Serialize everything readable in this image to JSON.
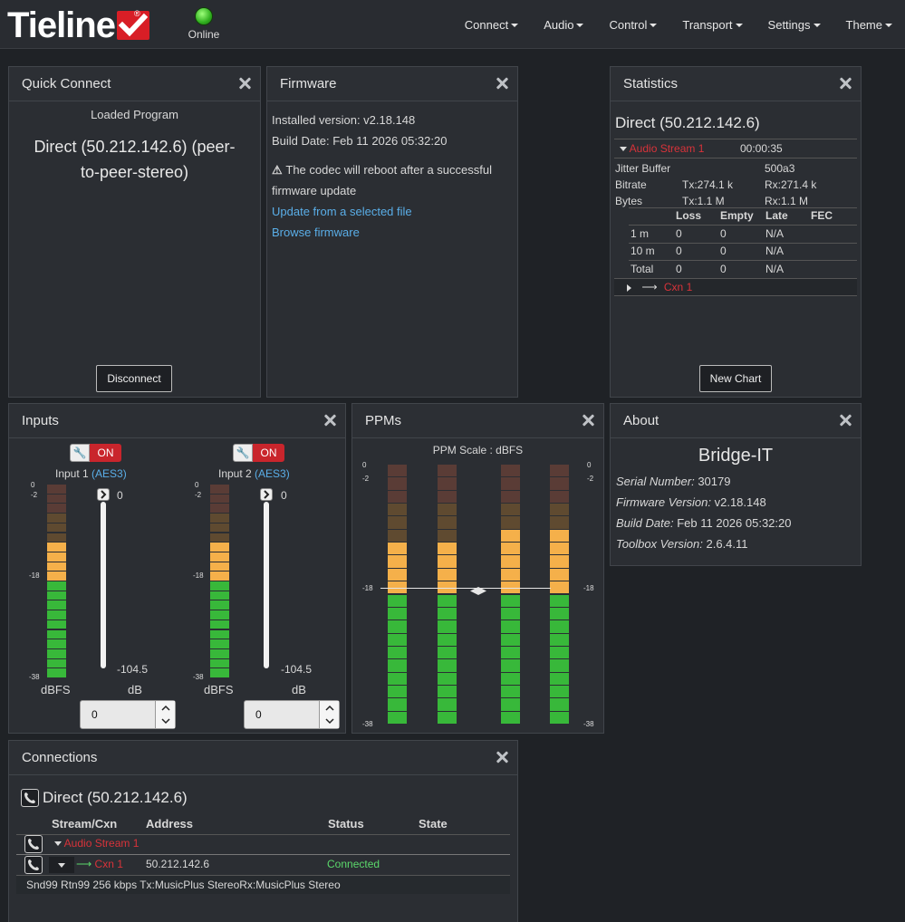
{
  "header": {
    "logo_text": "Tieline",
    "logo_reg": "®",
    "status_label": "Online",
    "status_color": "#2fae1e",
    "menu": [
      "Connect",
      "Audio",
      "Control",
      "Transport",
      "Settings",
      "Theme"
    ]
  },
  "quick_connect": {
    "title": "Quick Connect",
    "loaded_label": "Loaded Program",
    "program_line1": "Direct (50.212.142.6) (peer-",
    "program_line2": "to-peer-stereo)",
    "disconnect_label": "Disconnect"
  },
  "firmware": {
    "title": "Firmware",
    "installed": "Installed version: v2.18.148",
    "build_date": "Build Date: Feb 11 2026 05:32:20",
    "warning_line1": "The codec will reboot after a successful",
    "warning_line2": "firmware update",
    "update_link": "Update from a selected file",
    "browse_link": "Browse firmware"
  },
  "statistics": {
    "title": "Statistics",
    "connection": "Direct (50.212.142.6)",
    "stream_name": "Audio Stream 1",
    "stream_time": "00:00:35",
    "jitter_label": "Jitter Buffer",
    "jitter_value": "500a3",
    "bitrate_label": "Bitrate",
    "bitrate_tx": "Tx:274.1 k",
    "bitrate_rx": "Rx:271.4 k",
    "bytes_label": "Bytes",
    "bytes_tx": "Tx:1.1 M",
    "bytes_rx": "Rx:1.1 M",
    "headers": [
      "Loss",
      "Empty",
      "Late",
      "FEC"
    ],
    "rows": [
      {
        "label": "1 m",
        "loss": "0",
        "empty": "0",
        "late": "N/A"
      },
      {
        "label": "10 m",
        "loss": "0",
        "empty": "0",
        "late": "N/A"
      },
      {
        "label": "Total",
        "loss": "0",
        "empty": "0",
        "late": "N/A"
      }
    ],
    "cxn": "Cxn 1",
    "new_chart_label": "New Chart"
  },
  "inputs": {
    "title": "Inputs",
    "on_label": "ON",
    "channels": [
      {
        "name": "Input 1",
        "type": "(AES3)",
        "gain": "0",
        "floor": "-104.5",
        "spin": "0",
        "level": 0.72
      },
      {
        "name": "Input 2",
        "type": "(AES3)",
        "gain": "0",
        "floor": "-104.5",
        "spin": "0",
        "level": 0.72
      }
    ],
    "dbfs_label": "dBFS",
    "db_label": "dB",
    "scale_ticks": [
      "0",
      "-2",
      "-18",
      "-38"
    ]
  },
  "ppms": {
    "title": "PPMs",
    "scale_title": "PPM Scale",
    "scale_unit": ": dBFS",
    "scale_ticks": [
      "0",
      "-2",
      "-18",
      "-38"
    ],
    "levels": [
      0.72,
      0.72,
      0.77,
      0.74
    ]
  },
  "about": {
    "title": "About",
    "product": "Bridge-IT",
    "serial_label": "Serial Number:",
    "serial": "30179",
    "fw_label": "Firmware Version:",
    "fw": "v2.18.148",
    "build_label": "Build Date:",
    "build": "Feb 11 2026 05:32:20",
    "toolbox_label": "Toolbox Version:",
    "toolbox": "2.6.4.11"
  },
  "connections": {
    "title": "Connections",
    "connection": "Direct (50.212.142.6)",
    "headers": [
      "Stream/Cxn",
      "Address",
      "Status",
      "State"
    ],
    "stream_name": "Audio Stream 1",
    "cxn_name": "Cxn 1",
    "address": "50.212.142.6",
    "status": "Connected",
    "details": "Snd99 Rtn99 256 kbps Tx:MusicPlus StereoRx:MusicPlus Stereo"
  }
}
